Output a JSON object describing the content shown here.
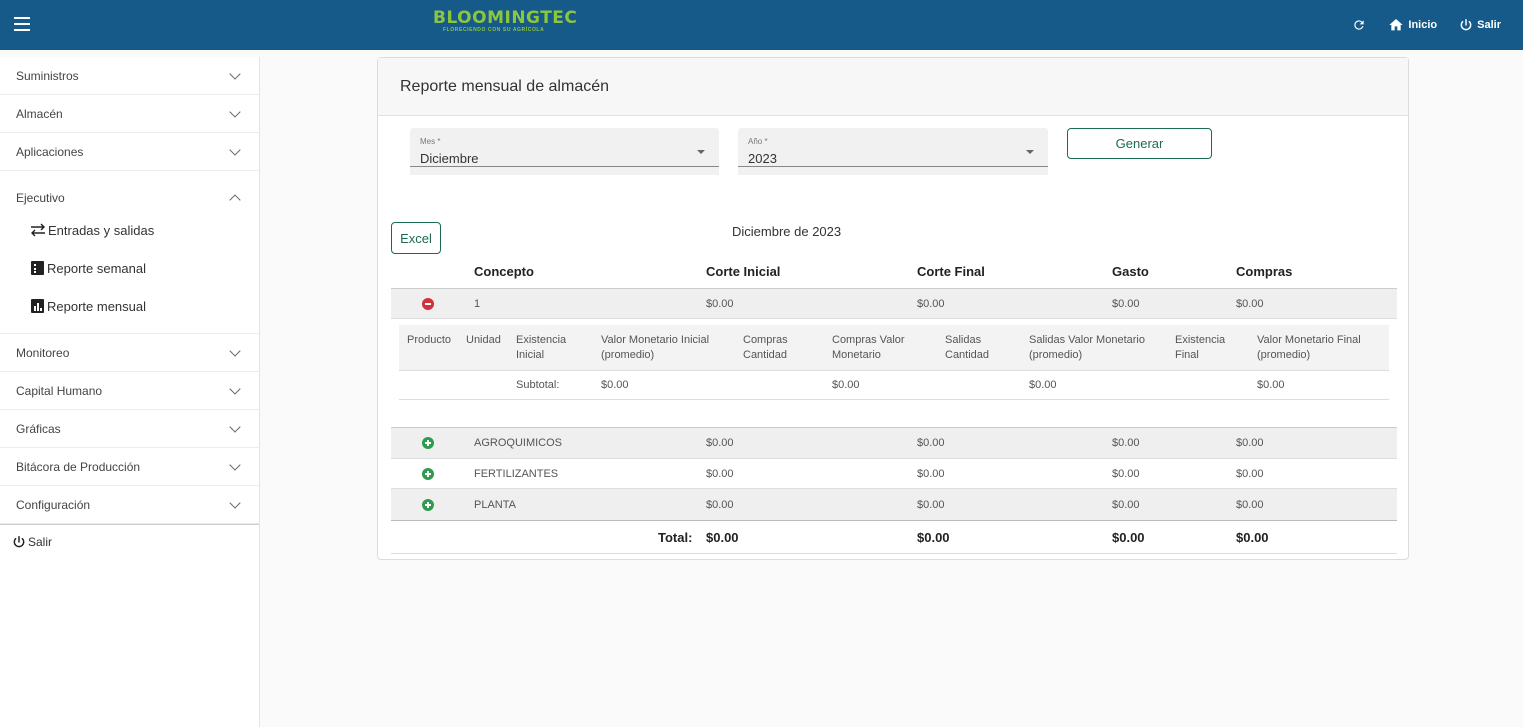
{
  "header": {
    "brand": "BLOOMINGTEC",
    "tagline": "FLORECIENDO CON SU AGRÍCOLA",
    "actions": {
      "home": "Inicio",
      "logout": "Salir"
    }
  },
  "sidebar": {
    "items": [
      {
        "label": "Suministros"
      },
      {
        "label": "Almacén"
      },
      {
        "label": "Aplicaciones"
      },
      {
        "label": "Ejecutivo"
      },
      {
        "label": "Monitoreo"
      },
      {
        "label": "Capital Humano"
      },
      {
        "label": "Gráficas"
      },
      {
        "label": "Bitácora de Producción"
      },
      {
        "label": "Configuración"
      }
    ],
    "ejecutivo_sub": [
      {
        "label": "Entradas y salidas",
        "icon": "swap-arrows-icon"
      },
      {
        "label": "Reporte semanal",
        "icon": "report-weekly-icon"
      },
      {
        "label": "Reporte mensual",
        "icon": "report-monthly-icon"
      }
    ],
    "logout": "Salir"
  },
  "report": {
    "title": "Reporte mensual de almacén",
    "month_field": {
      "label": "Mes *",
      "value": "Diciembre"
    },
    "year_field": {
      "label": "Año *",
      "value": "2023"
    },
    "generate_label": "Generar",
    "excel_label": "Excel",
    "period": "Diciembre de 2023",
    "columns": [
      "Concepto",
      "Corte Inicial",
      "Corte Final",
      "Gasto",
      "Compras"
    ],
    "expanded_row": {
      "concept": "1",
      "corte_inicial": "$0.00",
      "corte_final": "$0.00",
      "gasto": "$0.00",
      "compras": "$0.00"
    },
    "detail": {
      "columns": [
        "Producto",
        "Unidad",
        "Existencia Inicial",
        "Valor Monetario Inicial (promedio)",
        "Compras Cantidad",
        "Compras Valor Monetario",
        "Salidas Cantidad",
        "Salidas Valor Monetario (promedio)",
        "Existencia Final",
        "Valor Monetario Final (promedio)"
      ],
      "subtotal": {
        "label": "Subtotal:",
        "valor_inicial": "$0.00",
        "compras_valor": "$0.00",
        "salidas_valor": "$0.00",
        "valor_final": "$0.00"
      }
    },
    "rows": [
      {
        "concept": "AGROQUIMICOS",
        "corte_inicial": "$0.00",
        "corte_final": "$0.00",
        "gasto": "$0.00",
        "compras": "$0.00"
      },
      {
        "concept": "FERTILIZANTES",
        "corte_inicial": "$0.00",
        "corte_final": "$0.00",
        "gasto": "$0.00",
        "compras": "$0.00"
      },
      {
        "concept": "PLANTA",
        "corte_inicial": "$0.00",
        "corte_final": "$0.00",
        "gasto": "$0.00",
        "compras": "$0.00"
      }
    ],
    "total": {
      "label": "Total:",
      "corte_inicial": "$0.00",
      "corte_final": "$0.00",
      "gasto": "$0.00",
      "compras": "$0.00"
    }
  },
  "colors": {
    "header_bg": "#165a8a",
    "brand": "#8cc63f",
    "accent": "#1d6b4e",
    "collapse": "#d32f3c",
    "expand": "#2e9b4e"
  }
}
